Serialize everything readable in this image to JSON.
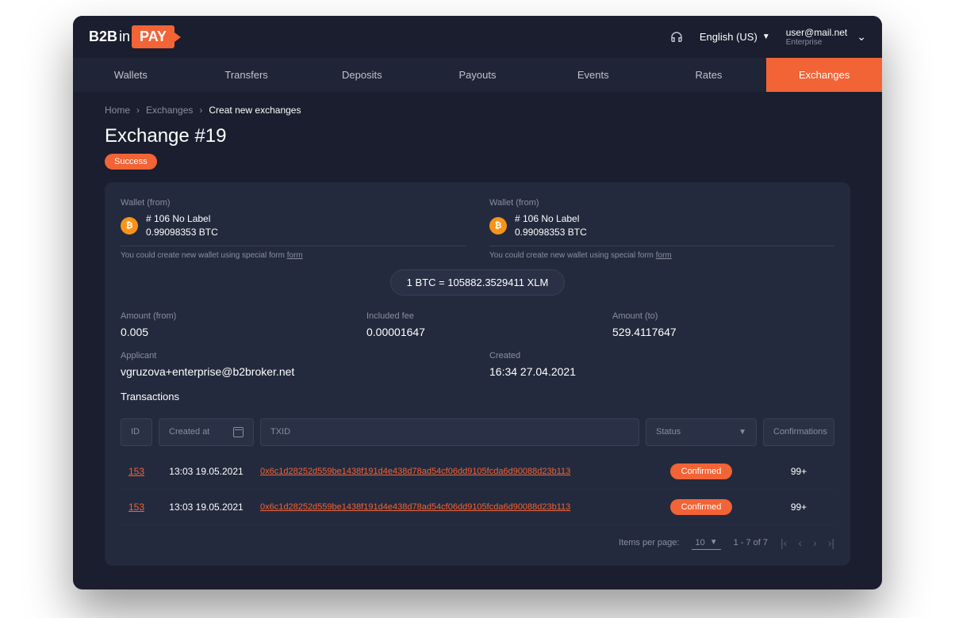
{
  "logo": {
    "b2b": "B2B",
    "in": "in",
    "pay": "PAY"
  },
  "header": {
    "language": "English (US)",
    "user_email": "user@mail.net",
    "user_type": "Enterprise"
  },
  "nav": [
    "Wallets",
    "Transfers",
    "Deposits",
    "Payouts",
    "Events",
    "Rates",
    "Exchanges"
  ],
  "nav_active": 6,
  "breadcrumb": {
    "home": "Home",
    "exchanges": "Exchanges",
    "current": "Creat new exchanges"
  },
  "page_title": "Exchange #19",
  "status_badge": "Success",
  "wallet_from": {
    "label": "Wallet (from)",
    "name": "# 106 No Label",
    "balance": "0.99098353 BTC",
    "hint": "You could create new wallet using special form",
    "hint_link": "form"
  },
  "wallet_to": {
    "label": "Wallet (from)",
    "name": "# 106 No Label",
    "balance": "0.99098353 BTC",
    "hint": "You could create new wallet using special form",
    "hint_link": "form"
  },
  "rate": "1 BTC = 105882.3529411 XLM",
  "amounts": {
    "from_label": "Amount (from)",
    "from_value": "0.005",
    "fee_label": "Included fee",
    "fee_value": "0.00001647",
    "to_label": "Amount (to)",
    "to_value": "529.4117647"
  },
  "meta": {
    "applicant_label": "Applicant",
    "applicant_value": "vgruzova+enterprise@b2broker.net",
    "created_label": "Created",
    "created_value": "16:34 27.04.2021"
  },
  "transactions": {
    "title": "Transactions",
    "filters": {
      "id": "ID",
      "created_at": "Created at",
      "txid": "TXID",
      "status": "Status",
      "confirmations": "Confirmations"
    },
    "rows": [
      {
        "id": "153",
        "created": "13:03 19.05.2021",
        "txid": "0x6c1d28252d559be1438f191d4e438d78ad54cf06dd9105fcda6d90088d23b113",
        "status": "Confirmed",
        "conf": "99+"
      },
      {
        "id": "153",
        "created": "13:03 19.05.2021",
        "txid": "0x6c1d28252d559be1438f191d4e438d78ad54cf06dd9105fcda6d90088d23b113",
        "status": "Confirmed",
        "conf": "99+"
      }
    ]
  },
  "pagination": {
    "items_label": "Items per page:",
    "items_value": "10",
    "range": "1 - 7 of 7"
  }
}
